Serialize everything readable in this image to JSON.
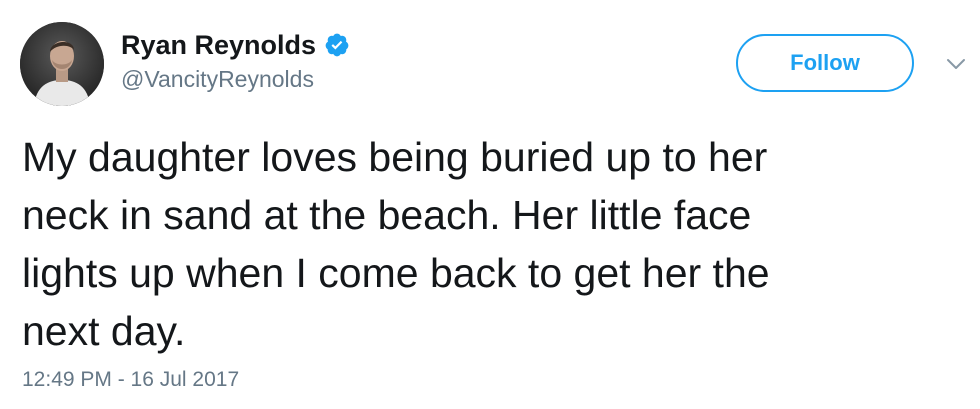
{
  "tweet": {
    "author": {
      "display_name": "Ryan Reynolds",
      "handle": "@VancityReynolds",
      "verified": true,
      "avatar_icon": "profile-photo"
    },
    "follow_button_label": "Follow",
    "more_menu_icon": "chevron-down-icon",
    "text": "My daughter loves being buried up to her\nneck in sand at the beach. Her little face\nlights up when I come back to get her the\nnext day.",
    "timestamp": "12:49 PM - 16 Jul 2017"
  },
  "colors": {
    "accent": "#1da1f2",
    "text_primary": "#14171a",
    "text_secondary": "#657786"
  }
}
